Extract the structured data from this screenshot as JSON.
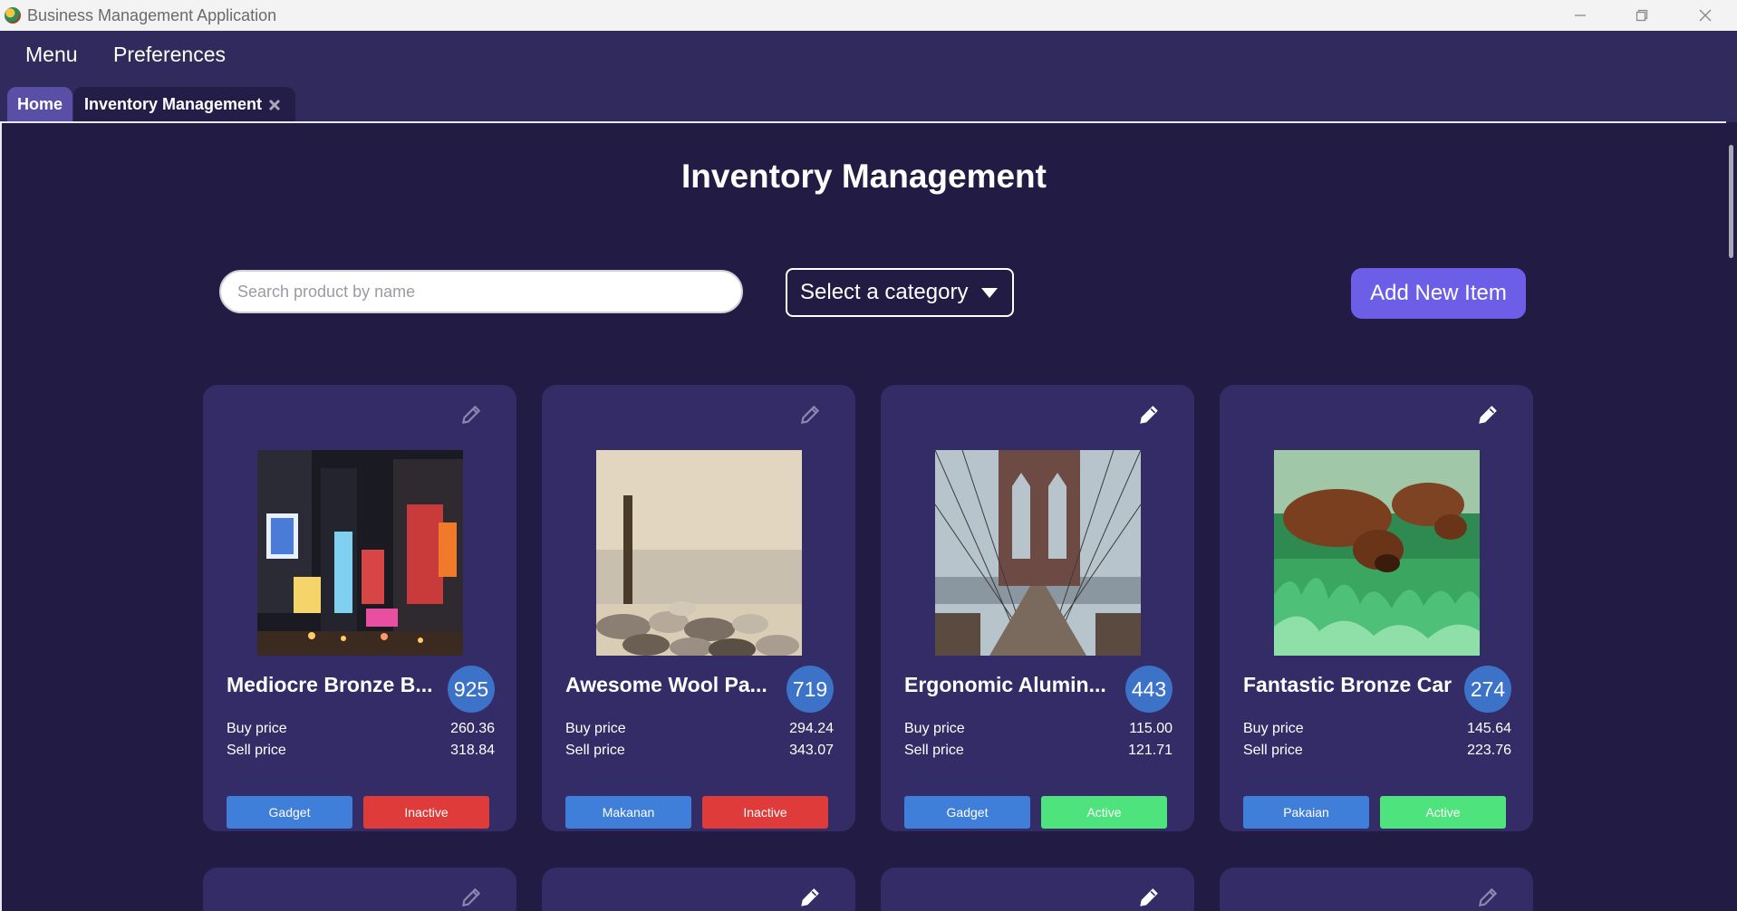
{
  "window": {
    "title": "Business Management Application"
  },
  "menubar": {
    "items": [
      "Menu",
      "Preferences"
    ]
  },
  "tabs": [
    {
      "label": "Home"
    },
    {
      "label": "Inventory Management"
    }
  ],
  "page": {
    "title": "Inventory Management",
    "search_placeholder": "Search product by name",
    "category_select": "Select a category",
    "add_button": "Add New Item"
  },
  "labels": {
    "buy": "Buy price",
    "sell": "Sell price"
  },
  "products": [
    {
      "name": "Mediocre Bronze B...",
      "qty": "925",
      "buy": "260.36",
      "sell": "318.84",
      "category": "Gadget",
      "status": "Inactive",
      "image": "city-night-photo",
      "edit_style": "dim"
    },
    {
      "name": "Awesome Wool Pa...",
      "qty": "719",
      "buy": "294.24",
      "sell": "343.07",
      "category": "Makanan",
      "status": "Inactive",
      "image": "rocks-pole-photo",
      "edit_style": "dim"
    },
    {
      "name": "Ergonomic Alumin...",
      "qty": "443",
      "buy": "115.00",
      "sell": "121.71",
      "category": "Gadget",
      "status": "Active",
      "image": "bridge-photo",
      "edit_style": "bright"
    },
    {
      "name": "Fantastic Bronze Car",
      "qty": "274",
      "buy": "145.64",
      "sell": "223.76",
      "category": "Pakaian",
      "status": "Active",
      "image": "dogs-grass-photo",
      "edit_style": "bright"
    }
  ],
  "colors": {
    "background": "#221c45",
    "card": "#332c66",
    "accent": "#6d5ee8",
    "category_badge": "#3f7fd9",
    "inactive": "#df3b3b",
    "active": "#4ee37c"
  }
}
